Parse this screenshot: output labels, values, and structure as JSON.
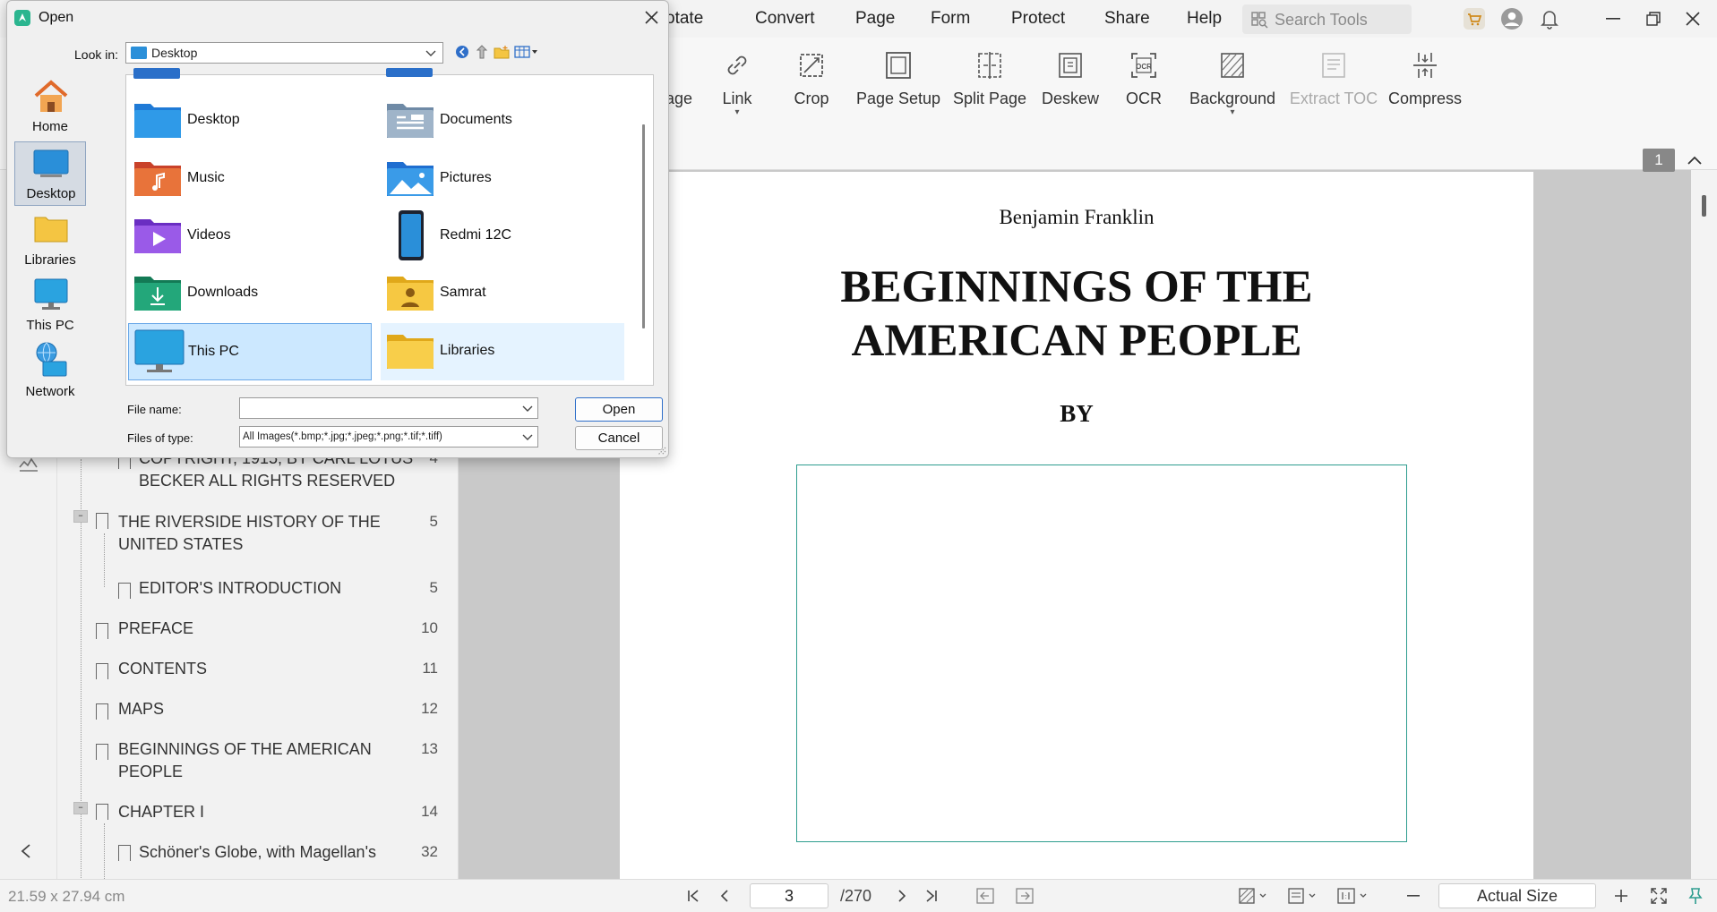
{
  "menubar": {
    "items": [
      "otate",
      "Convert",
      "Page",
      "Form",
      "Protect",
      "Share",
      "Help"
    ],
    "search_placeholder": "Search Tools"
  },
  "toolbar": {
    "tools": [
      {
        "label": "age",
        "icon": "page-icon",
        "disabled": false
      },
      {
        "label": "Link",
        "icon": "link-icon",
        "disabled": false
      },
      {
        "label": "Crop",
        "icon": "crop-icon",
        "disabled": false
      },
      {
        "label": "Page Setup",
        "icon": "page-setup-icon",
        "disabled": false
      },
      {
        "label": "Split Page",
        "icon": "split-page-icon",
        "disabled": false
      },
      {
        "label": "Deskew",
        "icon": "deskew-icon",
        "disabled": false
      },
      {
        "label": "OCR",
        "icon": "ocr-icon",
        "disabled": false
      },
      {
        "label": "Background",
        "icon": "background-icon",
        "disabled": false
      },
      {
        "label": "Extract TOC",
        "icon": "extract-toc-icon",
        "disabled": true
      },
      {
        "label": "Compress",
        "icon": "compress-icon",
        "disabled": false
      }
    ],
    "ocr_badge": "OCR"
  },
  "page_badge": "1",
  "bookmarks": [
    {
      "lines": [
        "COPYRIGHT, 1915, BY CARL LOTUS",
        "BECKER ALL RIGHTS RESERVED"
      ],
      "page": "4"
    },
    {
      "lines": [
        "THE RIVERSIDE HISTORY OF THE",
        "UNITED STATES"
      ],
      "page": "5"
    },
    {
      "lines": [
        "EDITOR'S INTRODUCTION"
      ],
      "page": "5"
    },
    {
      "lines": [
        "PREFACE"
      ],
      "page": "10"
    },
    {
      "lines": [
        "CONTENTS"
      ],
      "page": "11"
    },
    {
      "lines": [
        "MAPS"
      ],
      "page": "12"
    },
    {
      "lines": [
        "BEGINNINGS OF THE AMERICAN",
        "PEOPLE"
      ],
      "page": "13"
    },
    {
      "lines": [
        "CHAPTER I"
      ],
      "page": "14"
    },
    {
      "lines": [
        "Schöner's Globe, with Magellan's"
      ],
      "page": "32"
    }
  ],
  "document": {
    "author": "Benjamin Franklin",
    "title_line1": "BEGINNINGS OF THE",
    "title_line2": "AMERICAN PEOPLE",
    "by": "BY"
  },
  "statusbar": {
    "page_size": "21.59 x 27.94 cm",
    "current_page": "3",
    "total_pages": "/270",
    "zoom": "Actual Size"
  },
  "dialog": {
    "title": "Open",
    "look_in_label": "Look in:",
    "look_in_value": "Desktop",
    "places": [
      "Home",
      "Desktop",
      "Libraries",
      "This PC",
      "Network"
    ],
    "files": [
      {
        "name": "Desktop",
        "icon": "desktop-folder-icon"
      },
      {
        "name": "Documents",
        "icon": "documents-folder-icon"
      },
      {
        "name": "Music",
        "icon": "music-folder-icon"
      },
      {
        "name": "Pictures",
        "icon": "pictures-folder-icon"
      },
      {
        "name": "Videos",
        "icon": "videos-folder-icon"
      },
      {
        "name": "Redmi 12C",
        "icon": "phone-icon"
      },
      {
        "name": "Downloads",
        "icon": "downloads-folder-icon"
      },
      {
        "name": "Samrat",
        "icon": "user-folder-icon"
      },
      {
        "name": "This PC",
        "icon": "monitor-icon"
      },
      {
        "name": "Libraries",
        "icon": "folder-icon"
      }
    ],
    "file_name_label": "File name:",
    "file_name_value": "",
    "file_type_label": "Files of type:",
    "file_type_value": "All Images(*.bmp;*.jpg;*.jpeg;*.png;*.tif;*.tiff)",
    "open_label": "Open",
    "cancel_label": "Cancel"
  },
  "colors": {
    "accent": "#0078d4",
    "teal": "#2e9d8f",
    "selection": "#cce8ff"
  }
}
